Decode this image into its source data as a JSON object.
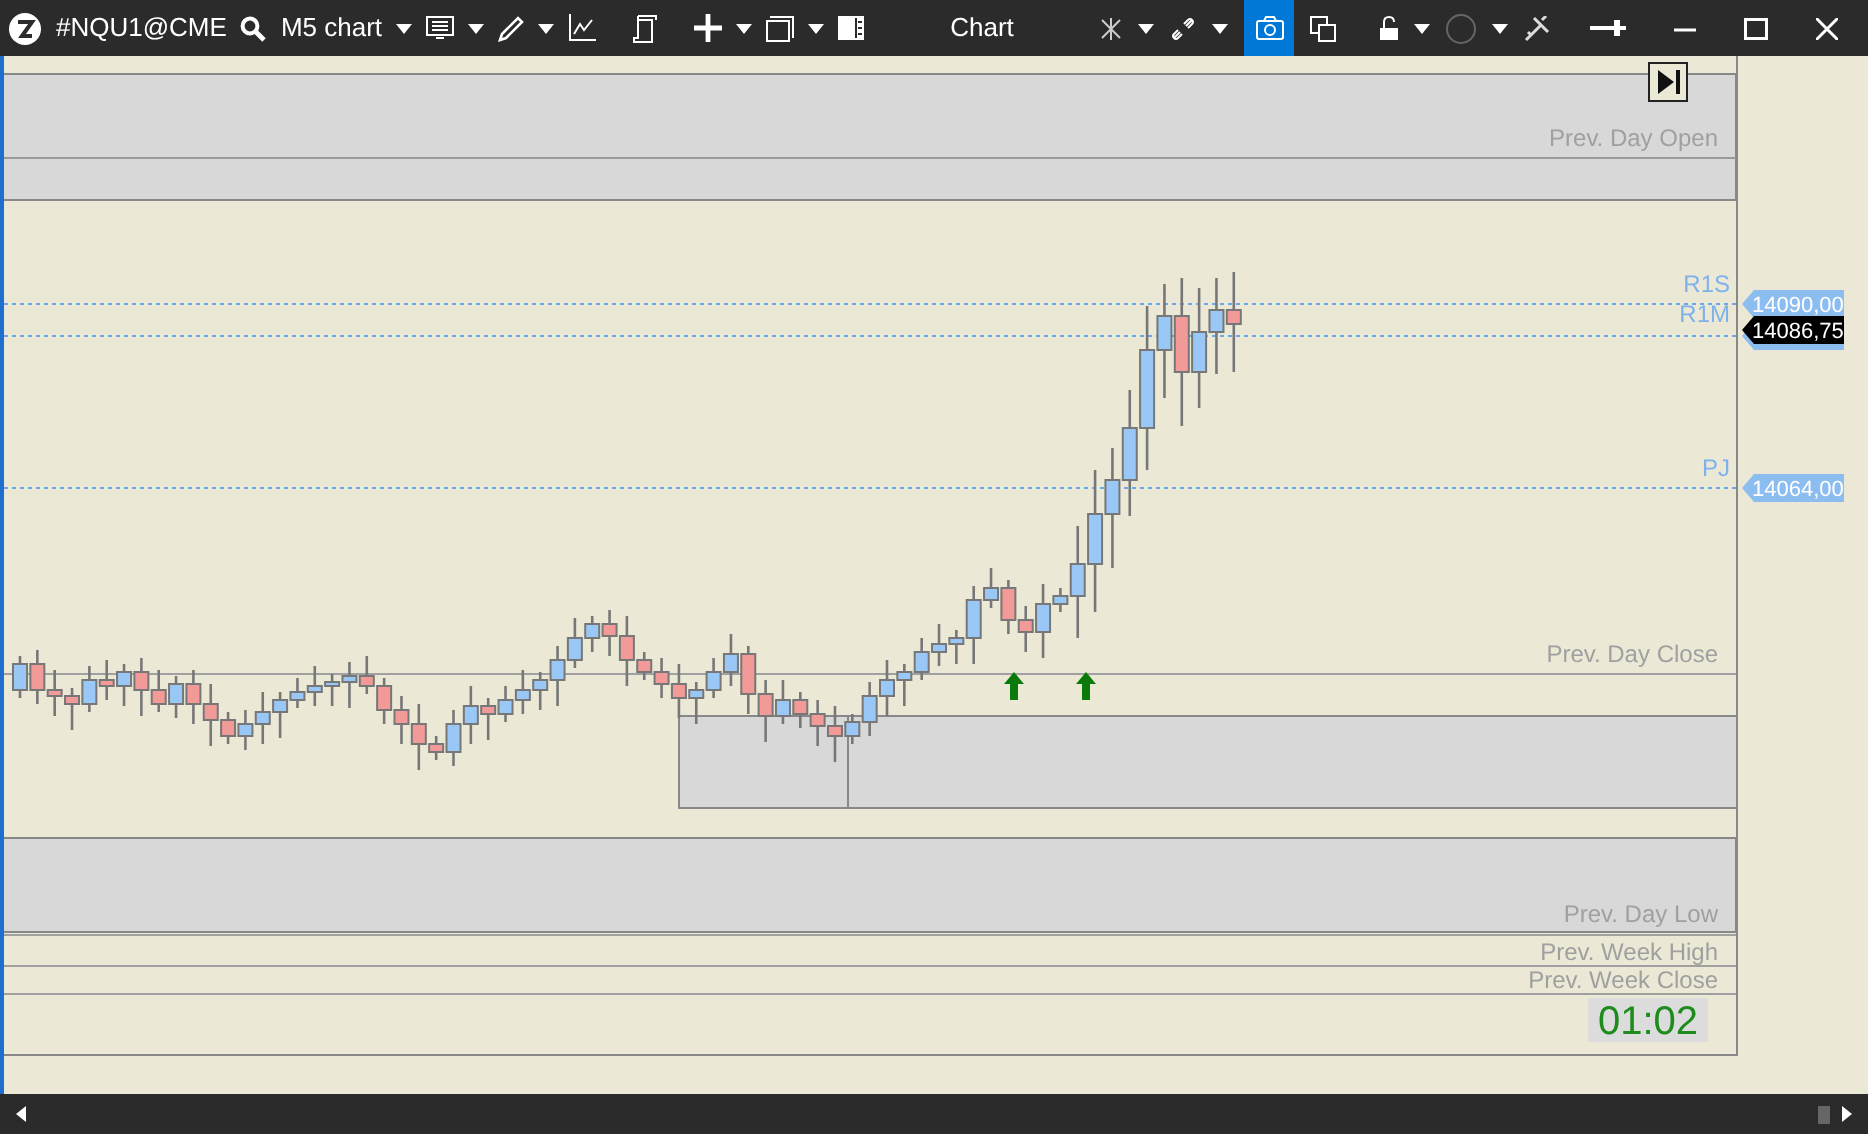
{
  "window": {
    "title": "Chart"
  },
  "toolbar": {
    "symbol": "#NQU1@CME",
    "timeframe": "M5 chart"
  },
  "snapshot_tool": {
    "active": true
  },
  "session_levels": [
    "Prev. Day Open",
    "Prev. Day Close",
    "Prev. Day Low",
    "Prev. Week High",
    "Prev. Week Close"
  ],
  "pivot_levels": [
    {
      "label": "R1S",
      "price": "14090,00"
    },
    {
      "label": "R1M"
    },
    {
      "label": "PJ",
      "price": "14064,00"
    }
  ],
  "current_price": "14086,75",
  "bar_timer": "01:02"
}
